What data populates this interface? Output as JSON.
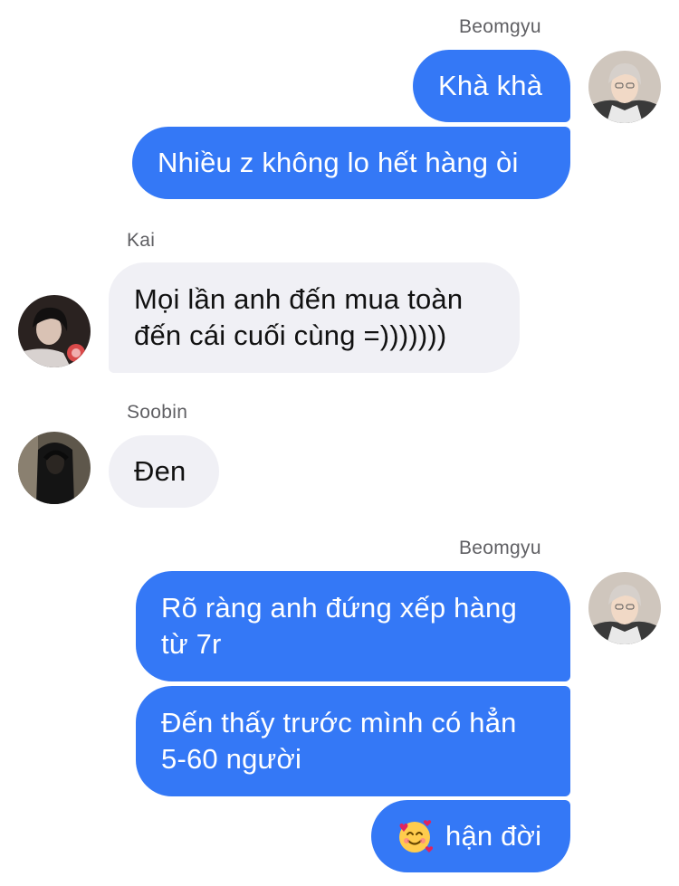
{
  "messages": {
    "group1": {
      "sender": "Beomgyu",
      "bubble1": "Khà khà",
      "bubble2": "Nhiều z không lo hết hàng òi"
    },
    "group2": {
      "sender": "Kai",
      "bubble1": "Mọi lần anh đến mua toàn đến cái cuối cùng =)))))))"
    },
    "group3": {
      "sender": "Soobin",
      "bubble1": "Đen"
    },
    "group4": {
      "sender": "Beomgyu",
      "bubble1": "Rõ ràng anh đứng xếp hàng từ 7r",
      "bubble2": "Đến thấy trước mình có hẳn 5-60 người",
      "bubble3_text": "hận đời",
      "bubble3_emoji": "smiling-face-with-hearts-icon"
    }
  },
  "colors": {
    "outgoing_bubble": "#3478f6",
    "incoming_bubble": "#f0f0f5",
    "sender_label": "#5f5f63"
  },
  "avatars": {
    "beomgyu": "avatar-beomgyu",
    "kai": "avatar-kai",
    "soobin": "avatar-soobin"
  }
}
